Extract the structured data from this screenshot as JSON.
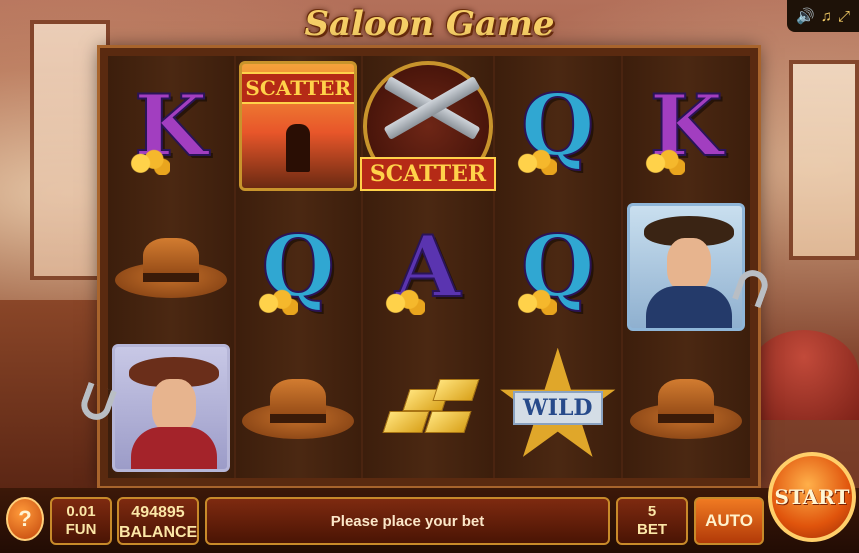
{
  "game": {
    "title": "Saloon Game"
  },
  "audio_panel": {
    "volume_icon": "speaker-icon",
    "music_icon": "music-note-icon",
    "fullscreen_icon": "fullscreen-icon"
  },
  "reels": [
    {
      "symbols": [
        "K",
        "hat",
        "woman"
      ]
    },
    {
      "symbols": [
        "scatter-cowboy",
        "Q",
        "hat"
      ]
    },
    {
      "symbols": [
        "scatter-guns",
        "A",
        "gold"
      ]
    },
    {
      "symbols": [
        "Q",
        "Q",
        "wild"
      ]
    },
    {
      "symbols": [
        "K",
        "cowboy-man",
        "hat"
      ]
    }
  ],
  "labels": {
    "scatter": "SCATTER",
    "wild": "WILD",
    "K": "K",
    "Q": "Q",
    "A": "A"
  },
  "controls": {
    "help_label": "?",
    "coin_value": "0.01",
    "currency_label": "FUN",
    "balance_value": "494895",
    "balance_label": "BALANCE",
    "message": "Please place your bet",
    "bet_value": "5",
    "bet_label": "BET",
    "auto_label": "AUTO",
    "start_label": "START"
  }
}
